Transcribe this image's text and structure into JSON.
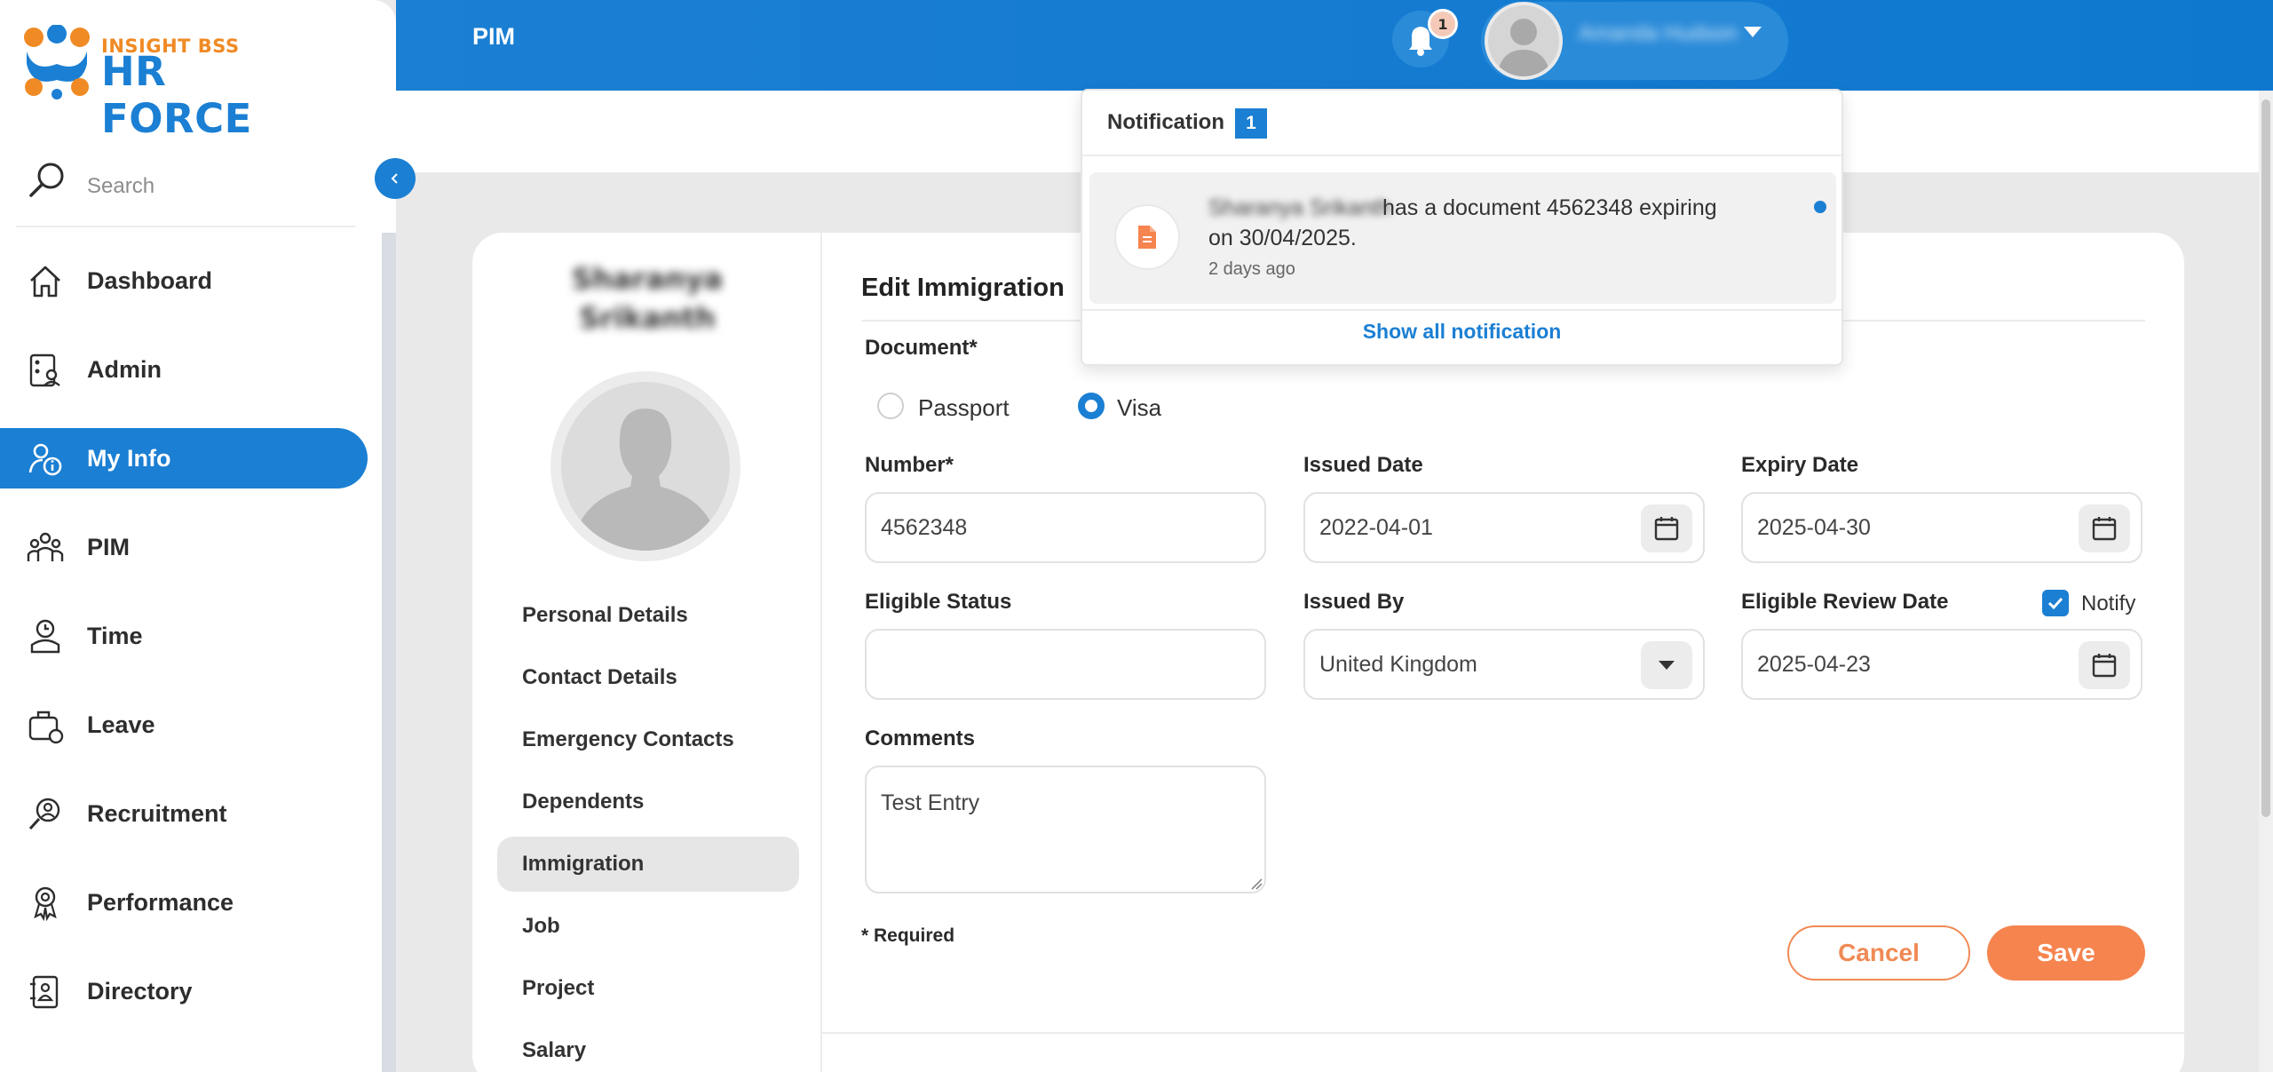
{
  "logo": {
    "line1": "INSIGHT BSS",
    "line2": "HR FORCE"
  },
  "search": {
    "placeholder": "Search"
  },
  "sidebar": {
    "items": [
      {
        "label": "Dashboard",
        "icon": "home-icon"
      },
      {
        "label": "Admin",
        "icon": "admin-icon"
      },
      {
        "label": "My Info",
        "icon": "user-info-icon",
        "active": true
      },
      {
        "label": "PIM",
        "icon": "people-icon"
      },
      {
        "label": "Time",
        "icon": "clock-user-icon"
      },
      {
        "label": "Leave",
        "icon": "briefcase-icon"
      },
      {
        "label": "Recruitment",
        "icon": "recruit-icon"
      },
      {
        "label": "Performance",
        "icon": "medal-icon"
      },
      {
        "label": "Directory",
        "icon": "address-book-icon"
      }
    ]
  },
  "topbar": {
    "title": "PIM",
    "notif_badge": "1",
    "user_name": "Amanda Hudson"
  },
  "profile": {
    "name_line1": "Sharanya",
    "name_line2": "Srikanth",
    "menu": [
      "Personal Details",
      "Contact Details",
      "Emergency Contacts",
      "Dependents",
      "Immigration",
      "Job",
      "Project",
      "Salary"
    ],
    "active_menu": "Immigration"
  },
  "form": {
    "title": "Edit Immigration",
    "document_label": "Document*",
    "radio_passport": "Passport",
    "radio_visa": "Visa",
    "selected_document": "Visa",
    "number_label": "Number*",
    "number_value": "4562348",
    "issued_date_label": "Issued Date",
    "issued_date_value": "2022-04-01",
    "expiry_date_label": "Expiry Date",
    "expiry_date_value": "2025-04-30",
    "eligible_status_label": "Eligible Status",
    "eligible_status_value": "",
    "issued_by_label": "Issued By",
    "issued_by_value": "United Kingdom",
    "review_date_label": "Eligible Review Date",
    "review_date_value": "2025-04-23",
    "notify_label": "Notify",
    "notify_checked": true,
    "comments_label": "Comments",
    "comments_value": "Test Entry",
    "required_note": "* Required",
    "cancel_label": "Cancel",
    "save_label": "Save"
  },
  "notification": {
    "title": "Notification",
    "count": "1",
    "item": {
      "name": "Sharanya Srikanth",
      "message_line1": "has a document 4562348 expiring",
      "message_line2": "on 30/04/2025.",
      "time": "2 days ago"
    },
    "show_all": "Show all notification"
  },
  "colors": {
    "primary": "#1b7fd3",
    "accent": "#f5844f"
  }
}
